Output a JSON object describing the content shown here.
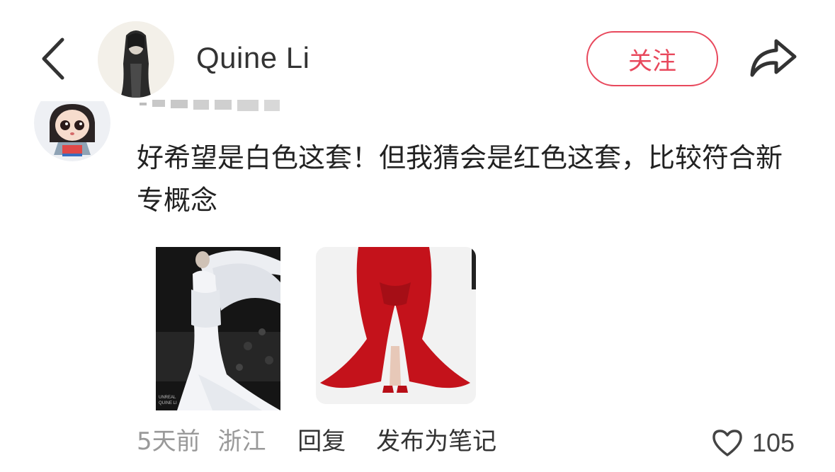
{
  "header": {
    "username": "Quine Li",
    "follow_label": "关注"
  },
  "comment": {
    "text": "好希望是白色这套！但我猜会是红色这套，比较符合新专概念",
    "time": "5天前",
    "location": "浙江",
    "reply_label": "回复",
    "publish_label": "发布为笔记",
    "like_count": "105",
    "image1_caption": [
      "UNREAL",
      "QUINE LI"
    ]
  },
  "colors": {
    "accent": "#e8485c",
    "text_primary": "#222222",
    "text_secondary": "#999999"
  },
  "icons": [
    "chevron-left-icon",
    "share-icon",
    "heart-icon"
  ]
}
